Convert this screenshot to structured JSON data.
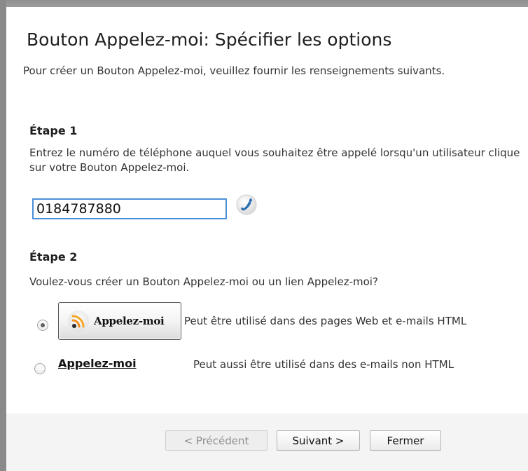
{
  "dialog": {
    "title": "Bouton Appelez-moi: Spécifier les options",
    "intro": "Pour créer un Bouton Appelez-moi, veuillez fournir les renseignements suivants."
  },
  "step1": {
    "title": "Étape 1",
    "description": "Entrez le numéro de téléphone auquel vous souhaitez être appelé lorsqu'un utilisateur clique sur votre Bouton Appelez-moi.",
    "phone_value": "0184787880",
    "phone_icon": "phone-handset-icon"
  },
  "step2": {
    "title": "Étape 2",
    "question": "Voulez-vous créer un Bouton Appelez-moi ou un lien Appelez-moi?",
    "options": [
      {
        "type": "button",
        "label": "Appelez-moi",
        "icon": "rss-feed-icon",
        "description": "Peut être utilisé dans des pages Web et e-mails HTML",
        "selected": true
      },
      {
        "type": "link",
        "label": "Appelez-moi",
        "description": "Peut aussi être utilisé dans des e-mails non HTML",
        "selected": false
      }
    ]
  },
  "footer": {
    "previous_label": "< Précédent",
    "next_label": "Suivant >",
    "close_label": "Fermer"
  },
  "colors": {
    "input_focus_border": "#4a90d9",
    "rss_orange": "#f28c1a",
    "phone_blue": "#2a6fb3",
    "footer_bg": "#f4f4f4"
  }
}
